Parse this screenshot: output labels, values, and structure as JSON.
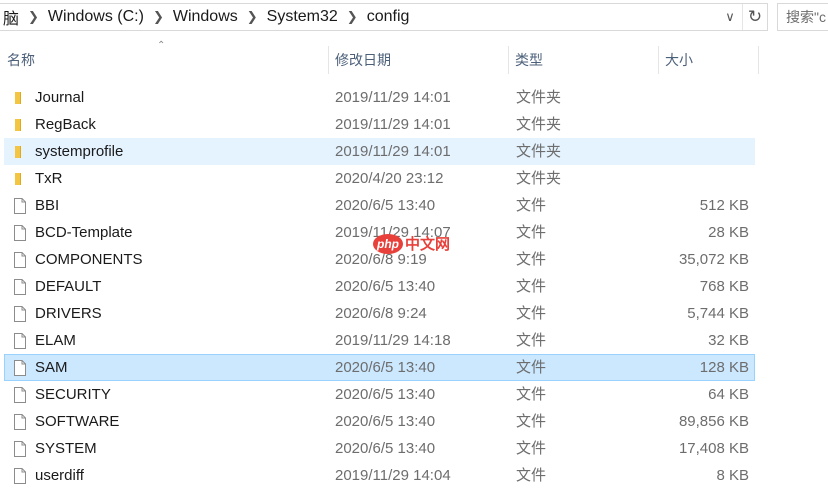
{
  "breadcrumb": {
    "items": [
      "脑",
      "Windows (C:)",
      "Windows",
      "System32",
      "config"
    ]
  },
  "search": {
    "placeholder": "搜索\"c"
  },
  "columns": {
    "name": "名称",
    "date": "修改日期",
    "type": "类型",
    "size": "大小"
  },
  "files": [
    {
      "name": "Journal",
      "date": "2019/11/29 14:01",
      "type": "文件夹",
      "size": "",
      "icon": "folder-icon"
    },
    {
      "name": "RegBack",
      "date": "2019/11/29 14:01",
      "type": "文件夹",
      "size": "",
      "icon": "folder-icon"
    },
    {
      "name": "systemprofile",
      "date": "2019/11/29 14:01",
      "type": "文件夹",
      "size": "",
      "icon": "folder-icon",
      "state": "hover"
    },
    {
      "name": "TxR",
      "date": "2020/4/20 23:12",
      "type": "文件夹",
      "size": "",
      "icon": "folder-icon"
    },
    {
      "name": "BBI",
      "date": "2020/6/5 13:40",
      "type": "文件",
      "size": "512 KB",
      "icon": "file-icon"
    },
    {
      "name": "BCD-Template",
      "date": "2019/11/29 14:07",
      "type": "文件",
      "size": "28 KB",
      "icon": "file-icon"
    },
    {
      "name": "COMPONENTS",
      "date": "2020/6/8 9:19",
      "type": "文件",
      "size": "35,072 KB",
      "icon": "file-icon"
    },
    {
      "name": "DEFAULT",
      "date": "2020/6/5 13:40",
      "type": "文件",
      "size": "768 KB",
      "icon": "file-icon"
    },
    {
      "name": "DRIVERS",
      "date": "2020/6/8 9:24",
      "type": "文件",
      "size": "5,744 KB",
      "icon": "file-icon"
    },
    {
      "name": "ELAM",
      "date": "2019/11/29 14:18",
      "type": "文件",
      "size": "32 KB",
      "icon": "file-icon"
    },
    {
      "name": "SAM",
      "date": "2020/6/5 13:40",
      "type": "文件",
      "size": "128 KB",
      "icon": "file-icon",
      "state": "selected"
    },
    {
      "name": "SECURITY",
      "date": "2020/6/5 13:40",
      "type": "文件",
      "size": "64 KB",
      "icon": "file-icon"
    },
    {
      "name": "SOFTWARE",
      "date": "2020/6/5 13:40",
      "type": "文件",
      "size": "89,856 KB",
      "icon": "file-icon"
    },
    {
      "name": "SYSTEM",
      "date": "2020/6/5 13:40",
      "type": "文件",
      "size": "17,408 KB",
      "icon": "file-icon"
    },
    {
      "name": "userdiff",
      "date": "2019/11/29 14:04",
      "type": "文件",
      "size": "8 KB",
      "icon": "file-icon"
    }
  ],
  "watermark": {
    "badge": "php",
    "text": "中文网"
  },
  "colors": {
    "selected_bg": "#cce8ff",
    "selected_border": "#99d1ff",
    "hover_bg": "#e5f3ff",
    "folder": "#f4c542",
    "watermark": "#e8403a"
  }
}
